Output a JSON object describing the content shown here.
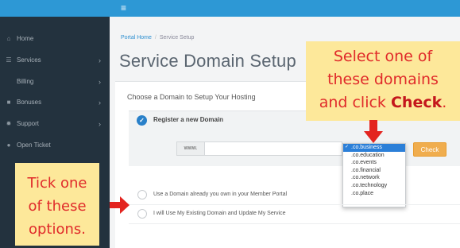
{
  "topbar": {
    "menu_icon": "hamburger-icon",
    "menu_glyph": "≡",
    "color": "#2d98d5"
  },
  "sidebar": {
    "items": [
      {
        "label": "Home",
        "icon": "home-icon",
        "glyph": "⌂",
        "has_chevron": false
      },
      {
        "label": "Services",
        "icon": "list-icon",
        "glyph": "☰",
        "has_chevron": true
      },
      {
        "label": "Billing",
        "icon": "",
        "glyph": "",
        "has_chevron": true
      },
      {
        "label": "Bonuses",
        "icon": "gift-icon",
        "glyph": "■",
        "has_chevron": true
      },
      {
        "label": "Support",
        "icon": "gear-icon",
        "glyph": "✹",
        "has_chevron": true
      },
      {
        "label": "Open Ticket",
        "icon": "comment-icon",
        "glyph": "●",
        "has_chevron": false
      }
    ],
    "chevron": "›"
  },
  "breadcrumb": {
    "home": "Portal Home",
    "separator": "/",
    "current": "Service Setup"
  },
  "page_title": "Service Domain Setup",
  "panel": {
    "heading": "Choose a Domain to Setup Your Hosting",
    "option_register": "Register a new Domain",
    "www_prefix": "www.",
    "domain_value": "",
    "tld_options": [
      ".co.business",
      ".co.education",
      ".co.events",
      ".co.financial",
      ".co.network",
      ".co.technology",
      ".co.place"
    ],
    "tld_selected": ".co.business",
    "check_button": "Check",
    "option_existing": "Use a Domain already you own in your Member Portal",
    "option_update": "I will Use My Existing Domain and Update My Service"
  },
  "annotations": {
    "top_lines": [
      "Select one of",
      "these domains",
      "and click"
    ],
    "top_bold": "Check",
    "top_end": ".",
    "left_lines": [
      "Tick one",
      "of these",
      "options."
    ],
    "callout_color": "#fde89a",
    "text_color": "#e02a2a"
  }
}
